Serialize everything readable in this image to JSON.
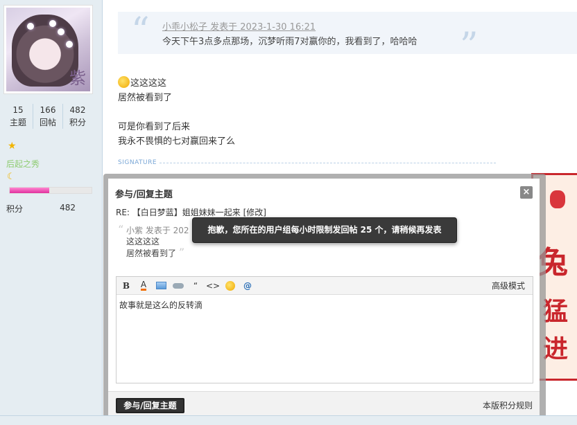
{
  "user": {
    "avatar_char": "紫",
    "stats": [
      {
        "value": "15",
        "label": "主题"
      },
      {
        "value": "166",
        "label": "回帖"
      },
      {
        "value": "482",
        "label": "积分"
      }
    ],
    "rank_name": "后起之秀",
    "rank_progress": 0.48,
    "score_label": "积分",
    "score_value": "482"
  },
  "post": {
    "quote_author": "小乖小松子 发表于 2023-1-30 16:21",
    "quote_text": "今天下午3点多点那场，沉梦听雨7对赢你的，我看到了，哈哈哈",
    "lines": [
      "这这这这",
      "居然被看到了",
      "",
      "可是你看到了后来",
      "我永不畏惧的七对赢回来了么"
    ],
    "signature_label": "SIGNATURE"
  },
  "modal": {
    "title": "参与/回复主题",
    "close_label": "×",
    "subject": "RE: 【白日梦蓝】姐姐妹妹一起来 [修改]",
    "quote_author": "小紫 发表于 202",
    "quote_lines": [
      "这这这这",
      "居然被看到了"
    ],
    "advanced_label": "高级模式",
    "editor_text": "故事就是这么的反转滴",
    "submit_label": "参与/回复主题",
    "rules_label": "本版积分规则"
  },
  "toast": {
    "message": "抱歉，您所在的用户组每小时限制发回帖 25 个，请稍候再发表"
  },
  "colors": {
    "sidebar_bg": "#e5edf2",
    "rank_green": "#8fcc72",
    "progress_pink": "#e0309d",
    "toast_bg": "#3a3a3a"
  }
}
